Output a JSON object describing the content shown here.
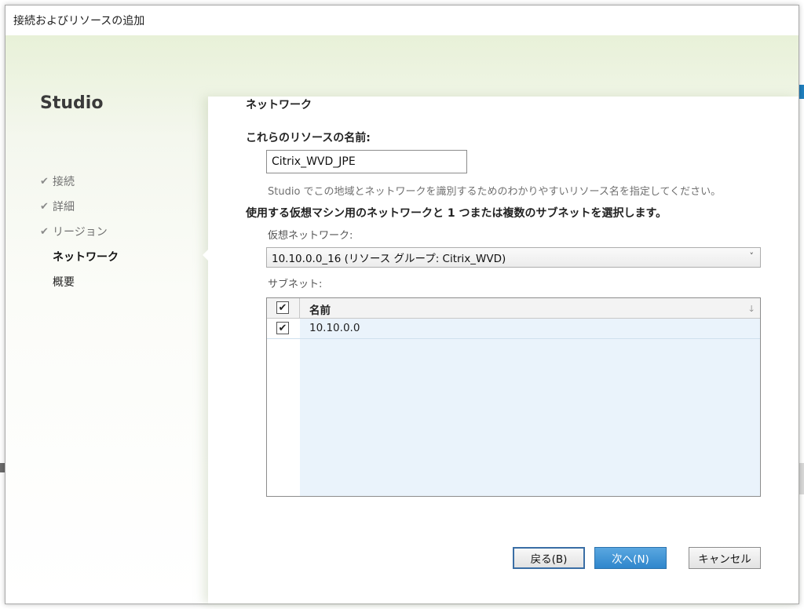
{
  "window": {
    "title": "接続およびリソースの追加"
  },
  "sidebar": {
    "title": "Studio",
    "steps": [
      {
        "label": "接続",
        "done": true
      },
      {
        "label": "詳細",
        "done": true
      },
      {
        "label": "リージョン",
        "done": true
      },
      {
        "label": "ネットワーク",
        "current": true
      },
      {
        "label": "概要"
      }
    ],
    "check_glyph": "✔"
  },
  "main": {
    "page_title": "ネットワーク",
    "name_label": "これらのリソースの名前:",
    "name_value": "Citrix_WVD_JPE",
    "name_hint": "Studio でこの地域とネットワークを識別するためのわかりやすいリソース名を指定してください。",
    "network_instruction": "使用する仮想マシン用のネットワークと 1 つまたは複数のサブネットを選択します。",
    "vnet_label": "仮想ネットワーク:",
    "vnet_selected": "10.10.0.0_16 (リソース グループ: Citrix_WVD)",
    "subnet_label": "サブネット:",
    "subnet_table": {
      "columns": [
        "名前"
      ],
      "header_checked": true,
      "rows": [
        {
          "name": "10.10.0.0",
          "checked": true
        }
      ]
    }
  },
  "footer": {
    "back_label": "戻る(B)",
    "next_label": "次へ(N)",
    "cancel_label": "キャンセル"
  },
  "icons": {
    "check": "✔",
    "chevron_down": "˅",
    "sort": "🡓"
  },
  "colors": {
    "accent_blue": "#2f86cc",
    "sidebar_gradient_top": "#e8f1d8",
    "grid_selection": "#eaf3fb"
  }
}
